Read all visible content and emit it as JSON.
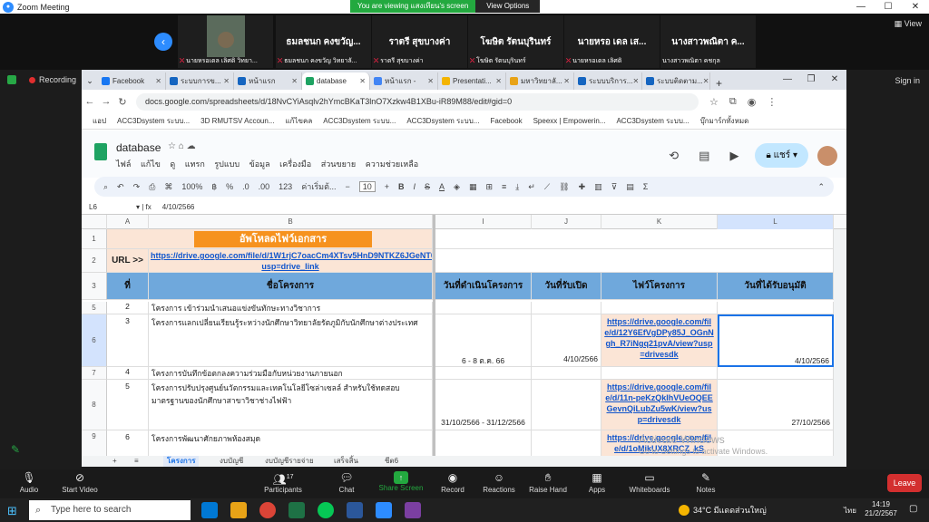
{
  "zoom": {
    "title": "Zoom Meeting",
    "viewing_banner": "You are viewing แสงเทียน's screen",
    "view_options": "View Options",
    "view_button": "View",
    "recording": "Recording",
    "sign_in": "Sign in",
    "participants": [
      {
        "name": "",
        "sub": "นายหรอเดล เลิศดิ วิทยา..."
      },
      {
        "name": "ธมลชนก คงขวัญ...",
        "sub": "ธมลชนก คงขวัญ วิทยาลั..."
      },
      {
        "name": "ราตรี สุขบางค่า",
        "sub": "ราตรี สุขบางค่า"
      },
      {
        "name": "โฆษิต รัตนบุรินทร์",
        "sub": "โฆษิต รัตนบุรินทร์"
      },
      {
        "name": "นายหรอ เดล เส...",
        "sub": "นายหรอเดล เลิศดิ"
      },
      {
        "name": "นางสาวพณิตา ค...",
        "sub": "นางสาวพณิตา คชกุล"
      }
    ],
    "controls": {
      "audio": "Audio",
      "start_video": "Start Video",
      "participants": "Participants",
      "participants_count": "17",
      "chat": "Chat",
      "share_screen": "Share Screen",
      "record": "Record",
      "reactions": "Reactions",
      "raise_hand": "Raise Hand",
      "apps": "Apps",
      "whiteboards": "Whiteboards",
      "notes": "Notes",
      "leave": "Leave"
    }
  },
  "browser": {
    "tabs": [
      "Facebook",
      "ระบบการข...",
      "หน้าแรก",
      "database",
      "หน้าแรก -",
      "Presentati...",
      "มหาวิทยาลั...",
      "ระบบบริการ...",
      "ระบบติดตาม..."
    ],
    "url": "docs.google.com/spreadsheets/d/18NvCYiAsqlv2hYmcBKaT3lnO7Xzkw4B1XBu-iR89M88/edit#gid=0",
    "bookmarks": [
      "แอป",
      "ACC3Dsystem ระบบ...",
      "3D RMUTSV Accoun...",
      "แก้ไขคล",
      "ACC3Dsystem ระบบ...",
      "ACC3Dsystem ระบบ...",
      "Facebook",
      "Speexx | Empowerin...",
      "ACC3Dsystem ระบบ...",
      "บุ๊กมาร์กทั้งหมด"
    ]
  },
  "sheets": {
    "doc_title": "database",
    "menus": [
      "ไฟล์",
      "แก้ไข",
      "ดู",
      "แทรก",
      "รูปแบบ",
      "ข้อมูล",
      "เครื่องมือ",
      "ส่วนขยาย",
      "ความช่วยเหลือ"
    ],
    "share_label": "แชร์",
    "zoom_level": "100%",
    "font_name": "ค่าเริ่มต้...",
    "font_size": "10",
    "cell_ref": "L6",
    "formula": "4/10/2566",
    "columns": [
      "A",
      "B",
      "I",
      "J",
      "K",
      "L"
    ],
    "title_banner": "อัพโหลดไฟว์เอกสาร",
    "url_label": "URL >>",
    "url_link": "https://drive.google.com/file/d/1W1rjC7oacCm4XTsv5HnD9NTKZ6JGeNT0/view?usp=drive_link",
    "headers": {
      "no": "ที่",
      "name": "ชื่อโครงการ",
      "date_run": "วันที่ดำเนินโครงการ",
      "date_open": "วันที่รับเปิด",
      "file": "ไฟว์โครงการ",
      "date_approve": "วันที่ได้รับอนุมัติ"
    },
    "rows": [
      {
        "row": "5",
        "no": "2",
        "name": "โครงการ เข้าร่วมนำเสนอแข่งขันทักษะทางวิชาการ",
        "date_run": "",
        "date_open": "",
        "file": "",
        "date_approve": ""
      },
      {
        "row": "6",
        "no": "3",
        "name": "โครงการแลกเปลี่ยนเรียนรู้ระหว่างนักศึกษาวิทยาลัยรัตภูมิกับนักศึกษาต่างประเทศ",
        "date_run": "6 - 8 ต.ค. 66",
        "date_open": "4/10/2566",
        "file": "https://drive.google.com/file/d/12Y6EfVgDPy85J_OGnNgh_R7iNgq21pvA/view?usp=drivesdk",
        "date_approve": "4/10/2566"
      },
      {
        "row": "7",
        "no": "4",
        "name": "โครงการบันทึกข้อตกลงความร่วมมือกับหน่วยงานภายนอก",
        "date_run": "",
        "date_open": "",
        "file": "",
        "date_approve": ""
      },
      {
        "row": "8",
        "no": "5",
        "name": "โครงการปรับปรุงศูนย์นวัตกรรมและเทคโนโลยีโซล่าเซลล์ สำหรับใช้ทดสอบมาตรฐานของนักศึกษาสาขาวิชาช่างไฟฟ้า",
        "date_run": "31/10/2566 - 31/12/2566",
        "date_open": "",
        "file": "https://drive.google.com/file/d/11n-peKzQkIhVUeOQEEGevnQiLubZu5wK/view?usp=drivesdk",
        "date_approve": "27/10/2566"
      },
      {
        "row": "9",
        "no": "6",
        "name": "โครงการพัฒนาศักยภาพห้องสมุด",
        "date_run": "",
        "date_open": "",
        "file": "https://drive.google.com/file/d/1oMikUX8XRCZ_kS",
        "date_approve": ""
      }
    ],
    "sheet_tabs": [
      "โครงการ",
      "งบบัญชี",
      "งบบัญชีรายจ่าย",
      "เสร็จสิ้น",
      "ชีต6"
    ]
  },
  "windows_activation": [
    "Activate Windows",
    "Go to Settings to activate Windows."
  ],
  "taskbar": {
    "search_placeholder": "Type here to search",
    "temperature": "34°C",
    "weather_text": "มีแดดส่วนใหญ่",
    "lang": "ไทย",
    "time": "14:19",
    "date": "21/2/2567"
  },
  "colors": {
    "zoom_blue": "#2d8cff",
    "zoom_green": "#23a93f",
    "header_blue": "#6fa8dc",
    "banner_orange": "#f6921e",
    "peach": "#fbe5d6",
    "leave_red": "#d32f2f"
  }
}
